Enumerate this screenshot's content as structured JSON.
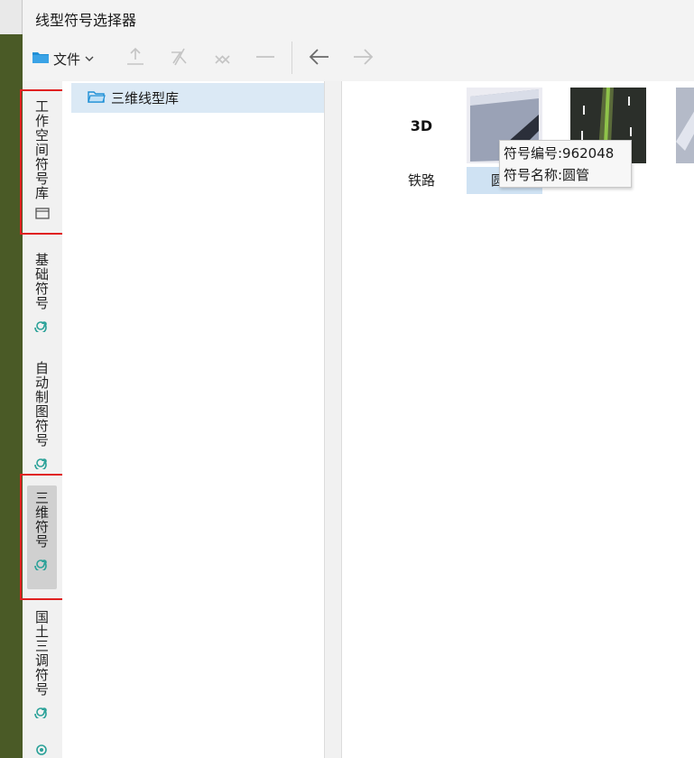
{
  "window": {
    "title": "线型符号选择器"
  },
  "toolbar": {
    "file_label": "文件",
    "icons": [
      "up-arrow-icon",
      "sort-icon",
      "clear-icon",
      "dash-icon",
      "back-arrow-icon",
      "forward-arrow-icon"
    ]
  },
  "side_tabs": [
    {
      "label": "工作空间符号库",
      "icon": "folder-icon"
    },
    {
      "label": "基础符号",
      "icon": "spiral-icon"
    },
    {
      "label": "自动制图符号",
      "icon": "spiral-icon"
    },
    {
      "label": "三维符号",
      "icon": "spiral-icon",
      "active": true
    },
    {
      "label": "国土三调符号",
      "icon": "spiral-icon"
    }
  ],
  "tree": {
    "items": [
      {
        "label": "三维线型库",
        "icon": "folder-icon",
        "selected": true
      }
    ]
  },
  "symbols": [
    {
      "thumb_text": "3D",
      "label": "铁路"
    },
    {
      "label": "圆管",
      "selected": true
    },
    {
      "label": ""
    },
    {
      "label": ""
    }
  ],
  "tooltip": {
    "line1": "符号编号:962048",
    "line2": "符号名称:圆管"
  },
  "colors": {
    "accent": "#1e8fd6",
    "highlight": "#cfe2f3",
    "annotation": "#e02020",
    "brand_strip": "#4a5a26"
  }
}
